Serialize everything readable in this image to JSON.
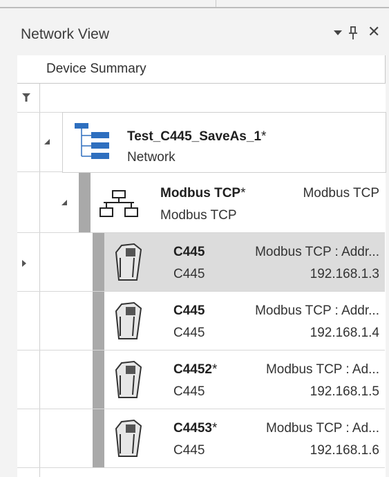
{
  "panel": {
    "title": "Network View",
    "controls": {
      "dropdown": "dropdown-icon",
      "pin": "ȡ",
      "close": "✕"
    }
  },
  "grid": {
    "column_header": "Device Summary",
    "network": {
      "name": "Test_C445_SaveAs_1",
      "modified": "*",
      "type": "Network"
    },
    "protocol": {
      "name": "Modbus TCP",
      "modified": "*",
      "description": "Modbus TCP",
      "type": "Modbus TCP"
    },
    "devices": [
      {
        "name": "C445",
        "modified": "",
        "description": "Modbus TCP : Addr...",
        "type": "C445",
        "ip": "192.168.1.3",
        "selected": true
      },
      {
        "name": "C445",
        "modified": "",
        "description": "Modbus TCP : Addr...",
        "type": "C445",
        "ip": "192.168.1.4",
        "selected": false
      },
      {
        "name": "C4452",
        "modified": "*",
        "description": "Modbus TCP : Ad...",
        "type": "C445",
        "ip": "192.168.1.5",
        "selected": false
      },
      {
        "name": "C4453",
        "modified": "*",
        "description": "Modbus TCP : Ad...",
        "type": "C445",
        "ip": "192.168.1.6",
        "selected": false
      }
    ]
  },
  "colors": {
    "accent_blue": "#2e6fbf",
    "selected_row": "#dcdcdc",
    "depth_bar": "#a9a9a9"
  }
}
